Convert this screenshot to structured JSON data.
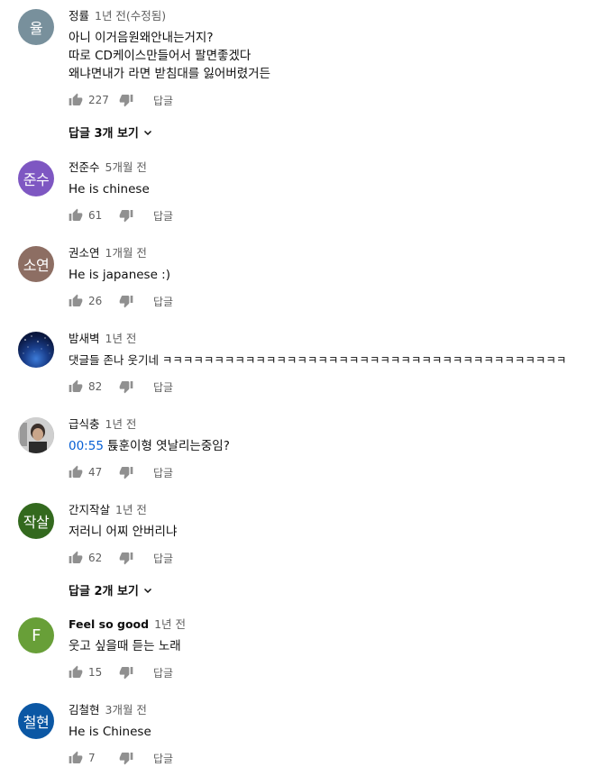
{
  "reply_label": "답글",
  "comments": [
    {
      "avatar_text": "율",
      "avatar_color": "#78909c",
      "author": "정률",
      "time": "1년 전(수정됨)",
      "text": "아니 이거음원왜안내는거지?\n따로 CD케이스만들어서 팔면좋겠다\n왜냐면내가 라면 받침대를 잃어버렸거든",
      "likes": "227",
      "replies": "답글 3개 보기"
    },
    {
      "avatar_text": "준수",
      "avatar_color": "#7e57c2",
      "author": "전준수",
      "time": "5개월 전",
      "text": "He is chinese",
      "likes": "61"
    },
    {
      "avatar_text": "소연",
      "avatar_color": "#8d6e63",
      "author": "권소연",
      "time": "1개월 전",
      "text": "He is japanese :)",
      "likes": "26"
    },
    {
      "avatar_text": "",
      "author": "밤새벽",
      "time": "1년 전",
      "text": "댓글들 존나 웃기네 ㅋㅋㅋㅋㅋㅋㅋㅋㅋㅋㅋㅋㅋㅋㅋㅋㅋㅋㅋㅋㅋㅋㅋㅋㅋㅋㅋㅋㅋㅋㅋㅋㅋㅋㅋㅋㅋㅋㅋ",
      "likes": "82"
    },
    {
      "avatar_text": "",
      "author": "급식충",
      "time": "1년 전",
      "timestamp": "00:55",
      "text": " 튡훈이형 엿날리는중임?",
      "likes": "47"
    },
    {
      "avatar_text": "작살",
      "avatar_color": "#33691e",
      "author": "간지작살",
      "time": "1년 전",
      "text": "저러니 어찌 안버리냐",
      "likes": "62",
      "replies": "답글 2개 보기"
    },
    {
      "avatar_text": "F",
      "avatar_color": "#689f38",
      "author": "Feel so good",
      "time": "1년 전",
      "text": "웃고 싶을때 듣는 노래",
      "likes": "15"
    },
    {
      "avatar_text": "철현",
      "avatar_color": "#0b57a4",
      "author": "김철현",
      "time": "3개월 전",
      "text": "He is Chinese",
      "likes": "7"
    }
  ]
}
